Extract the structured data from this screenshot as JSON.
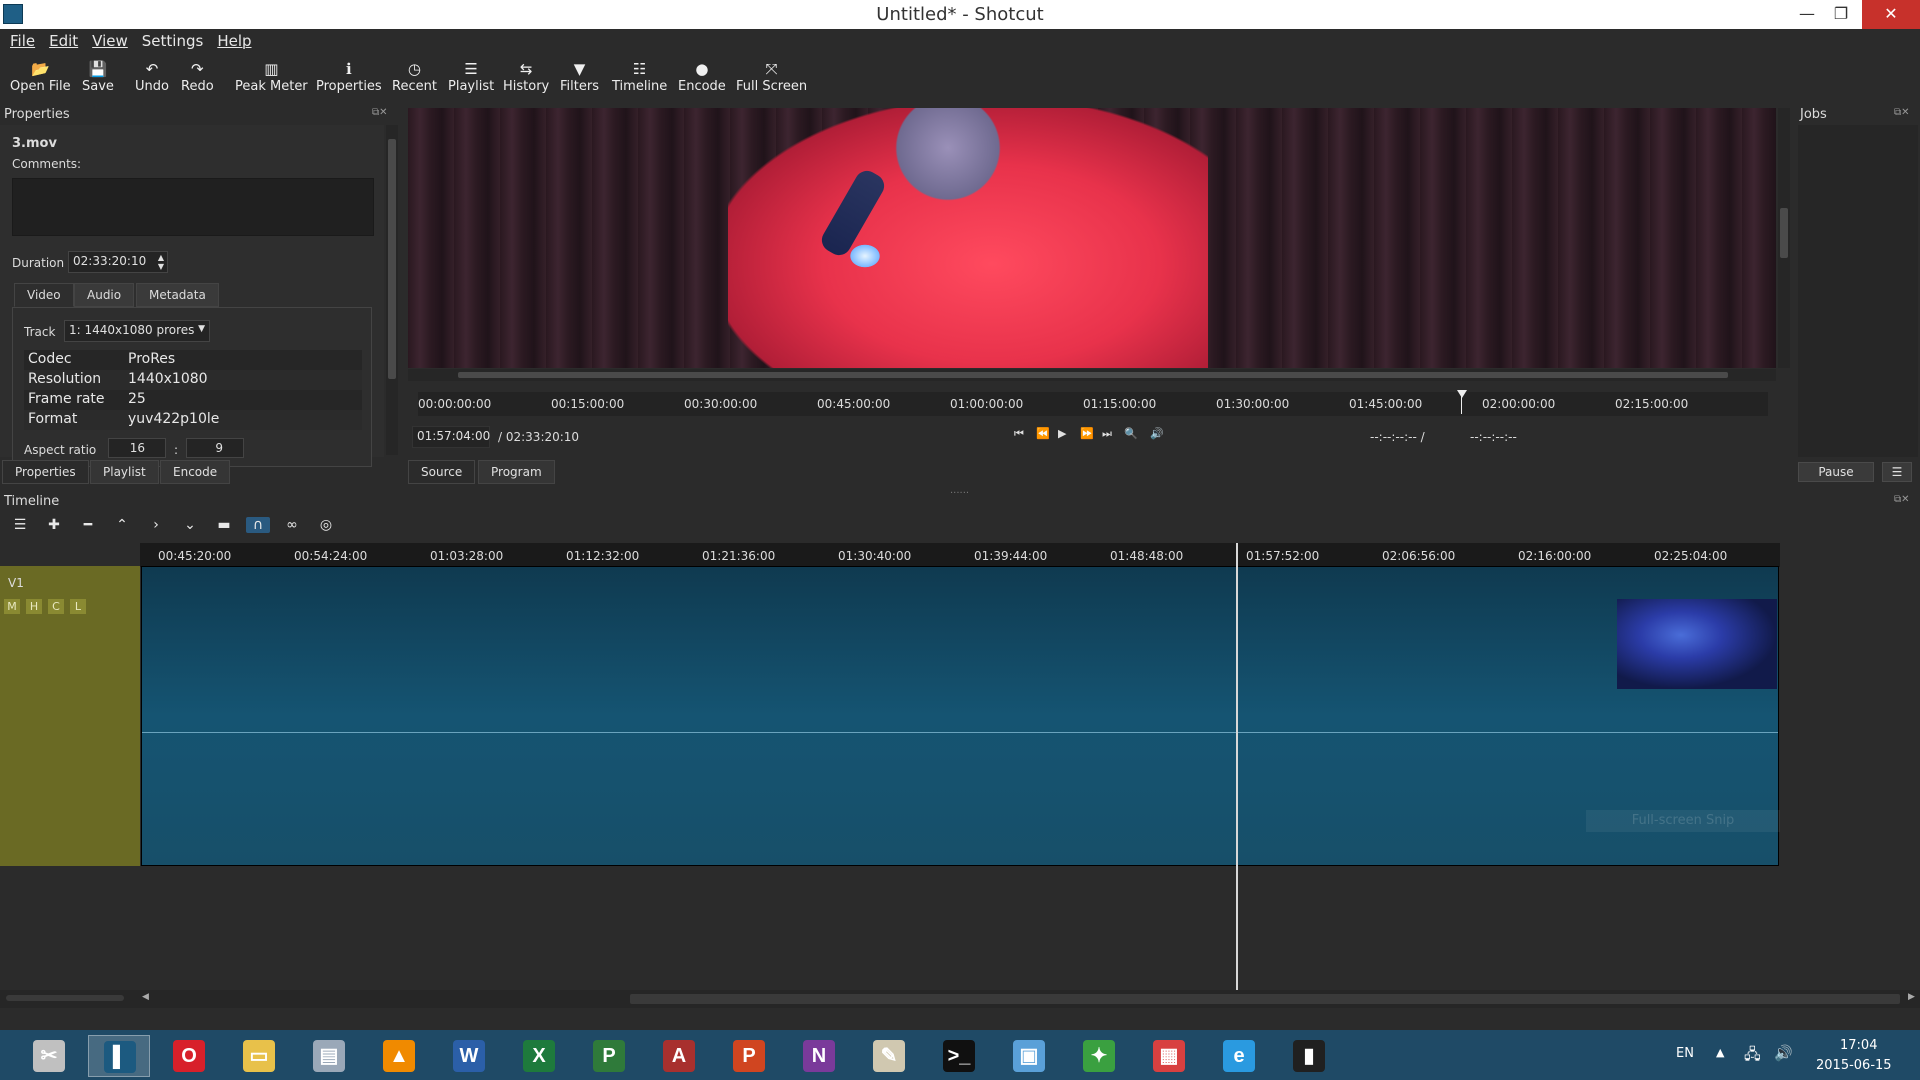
{
  "window": {
    "title": "Untitled* - Shotcut",
    "minimize": "—",
    "maximize": "❐",
    "close": "✕"
  },
  "menu": [
    "File",
    "Edit",
    "View",
    "Settings",
    "Help"
  ],
  "toolbar": [
    {
      "label": "Open File",
      "icon": "folder-open-icon",
      "glyph": "📂"
    },
    {
      "label": "Save",
      "icon": "save-icon",
      "glyph": "💾"
    },
    {
      "label": "Undo",
      "icon": "undo-icon",
      "glyph": "↶"
    },
    {
      "label": "Redo",
      "icon": "redo-icon",
      "glyph": "↷"
    },
    {
      "label": "Peak Meter",
      "icon": "peak-meter-icon",
      "glyph": "▥"
    },
    {
      "label": "Properties",
      "icon": "info-icon",
      "glyph": "ℹ"
    },
    {
      "label": "Recent",
      "icon": "clock-icon",
      "glyph": "◷"
    },
    {
      "label": "Playlist",
      "icon": "list-icon",
      "glyph": "☰"
    },
    {
      "label": "History",
      "icon": "history-icon",
      "glyph": "⇆"
    },
    {
      "label": "Filters",
      "icon": "filter-icon",
      "glyph": "▼"
    },
    {
      "label": "Timeline",
      "icon": "timeline-icon",
      "glyph": "☷"
    },
    {
      "label": "Encode",
      "icon": "record-icon",
      "glyph": "●"
    },
    {
      "label": "Full Screen",
      "icon": "fullscreen-icon",
      "glyph": "⤧"
    }
  ],
  "properties": {
    "title": "Properties",
    "filename": "3.mov",
    "comments_label": "Comments:",
    "duration_label": "Duration",
    "duration_value": "02:33:20:10",
    "tabs": [
      "Video",
      "Audio",
      "Metadata"
    ],
    "track_label": "Track",
    "track_value": "1: 1440x1080 prores",
    "rows": [
      {
        "key": "Codec",
        "value": "ProRes"
      },
      {
        "key": "Resolution",
        "value": "1440x1080"
      },
      {
        "key": "Frame rate",
        "value": "25"
      },
      {
        "key": "Format",
        "value": "yuv422p10le"
      }
    ],
    "aspect_label": "Aspect ratio",
    "aspect_w": "16",
    "aspect_sep": ":",
    "aspect_h": "9"
  },
  "left_bottom_tabs": [
    "Properties",
    "Playlist",
    "Encode"
  ],
  "player": {
    "ruler_ticks": [
      "00:00:00:00",
      "00:15:00:00",
      "00:30:00:00",
      "00:45:00:00",
      "01:00:00:00",
      "01:15:00:00",
      "01:30:00:00",
      "01:45:00:00",
      "02:00:00:00",
      "02:15:00:00"
    ],
    "position": "01:57:04:00",
    "total": "/ 02:33:20:10",
    "in_point": "--:--:--:-- /",
    "out_point": "--:--:--:--",
    "tabs": [
      "Source",
      "Program"
    ],
    "controls": [
      {
        "icon": "skip-start-icon",
        "glyph": "⏮"
      },
      {
        "icon": "rewind-icon",
        "glyph": "⏪"
      },
      {
        "icon": "play-icon",
        "glyph": "▶"
      },
      {
        "icon": "fast-forward-icon",
        "glyph": "⏩"
      },
      {
        "icon": "skip-end-icon",
        "glyph": "⏭"
      },
      {
        "icon": "zoom-icon",
        "glyph": "🔍"
      },
      {
        "icon": "volume-icon",
        "glyph": "🔊"
      }
    ]
  },
  "jobs": {
    "title": "Jobs",
    "pause_label": "Pause",
    "menu_glyph": "☰"
  },
  "timeline": {
    "title": "Timeline",
    "tools": [
      {
        "icon": "menu-icon",
        "glyph": "☰"
      },
      {
        "icon": "append-icon",
        "glyph": "✚"
      },
      {
        "icon": "remove-icon",
        "glyph": "━"
      },
      {
        "icon": "lift-icon",
        "glyph": "⌃"
      },
      {
        "icon": "overwrite-icon",
        "glyph": "›"
      },
      {
        "icon": "insert-icon",
        "glyph": "⌄"
      },
      {
        "icon": "split-icon",
        "glyph": "▬"
      },
      {
        "icon": "snap-icon",
        "glyph": "∩"
      },
      {
        "icon": "ripple-icon",
        "glyph": "∞"
      },
      {
        "icon": "scrub-icon",
        "glyph": "◎"
      }
    ],
    "ruler_ticks": [
      "00:45:20:00",
      "00:54:24:00",
      "01:03:28:00",
      "01:12:32:00",
      "01:21:36:00",
      "01:30:40:00",
      "01:39:44:00",
      "01:48:48:00",
      "01:57:52:00",
      "02:06:56:00",
      "02:16:00:00",
      "02:25:04:00"
    ],
    "track_name": "V1",
    "track_buttons": [
      "M",
      "H",
      "C",
      "L"
    ],
    "snip_hint": "Full-screen Snip"
  },
  "taskbar": {
    "apps": [
      {
        "name": "snipping-tool-icon",
        "color": "#c0c0c0",
        "glyph": "✂"
      },
      {
        "name": "shotcut-icon",
        "color": "#1c5a80",
        "glyph": "▌"
      },
      {
        "name": "opera-icon",
        "color": "#d8202a",
        "glyph": "O"
      },
      {
        "name": "file-explorer-icon",
        "color": "#e8c14a",
        "glyph": "▭"
      },
      {
        "name": "resource-monitor-icon",
        "color": "#9aa8b8",
        "glyph": "▤"
      },
      {
        "name": "vlc-icon",
        "color": "#f08a00",
        "glyph": "▲"
      },
      {
        "name": "word-icon",
        "color": "#2b5fa8",
        "glyph": "W"
      },
      {
        "name": "excel-icon",
        "color": "#1e7a3c",
        "glyph": "X"
      },
      {
        "name": "project-icon",
        "color": "#2f7a3a",
        "glyph": "P"
      },
      {
        "name": "access-icon",
        "color": "#a8302e",
        "glyph": "A"
      },
      {
        "name": "powerpoint-icon",
        "color": "#d04520",
        "glyph": "P"
      },
      {
        "name": "onenote-icon",
        "color": "#7a3a9a",
        "glyph": "N"
      },
      {
        "name": "paint-icon",
        "color": "#d0c8b0",
        "glyph": "✎"
      },
      {
        "name": "command-prompt-icon",
        "color": "#101010",
        "glyph": ">_"
      },
      {
        "name": "remote-desktop-icon",
        "color": "#5aa0d8",
        "glyph": "▣"
      },
      {
        "name": "green-app-icon",
        "color": "#3aa040",
        "glyph": "✦"
      },
      {
        "name": "image-viewer-icon",
        "color": "#d84040",
        "glyph": "▦"
      },
      {
        "name": "internet-explorer-icon",
        "color": "#2a9ae0",
        "glyph": "e"
      },
      {
        "name": "video-app-icon",
        "color": "#202020",
        "glyph": "▮"
      }
    ],
    "lang": "EN",
    "time": "17:04",
    "date": "2015-06-15"
  }
}
